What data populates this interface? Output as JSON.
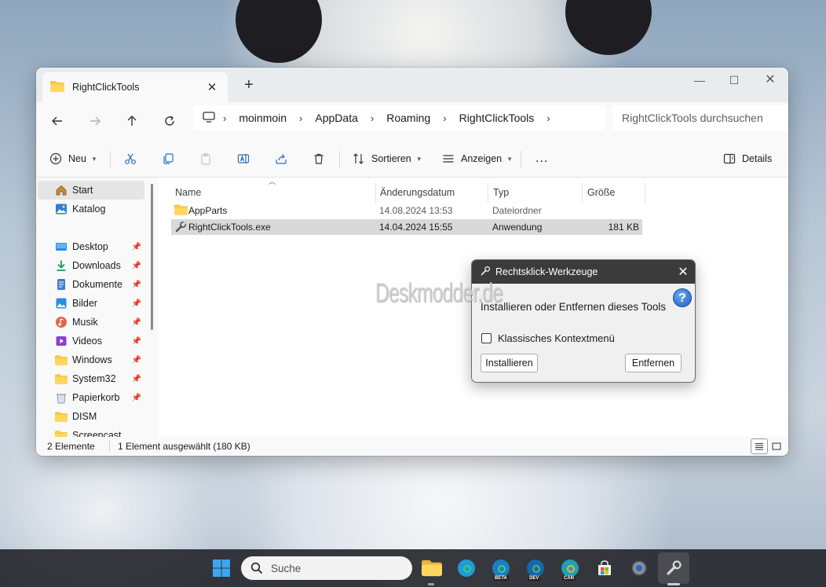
{
  "explorer": {
    "tab_title": "RightClickTools",
    "breadcrumb": [
      "moinmoin",
      "AppData",
      "Roaming",
      "RightClickTools"
    ],
    "search_placeholder": "RightClickTools durchsuchen",
    "toolbar": {
      "new_label": "Neu",
      "sort_label": "Sortieren",
      "view_label": "Anzeigen",
      "more_label": "...",
      "details_label": "Details"
    },
    "sidebar": {
      "items": [
        {
          "label": "Start",
          "icon": "home-icon"
        },
        {
          "label": "Katalog",
          "icon": "gallery-icon"
        },
        {
          "label": "Desktop",
          "icon": "desktop-icon"
        },
        {
          "label": "Downloads",
          "icon": "downloads-icon"
        },
        {
          "label": "Dokumente",
          "icon": "documents-icon"
        },
        {
          "label": "Bilder",
          "icon": "pictures-icon"
        },
        {
          "label": "Musik",
          "icon": "music-icon"
        },
        {
          "label": "Videos",
          "icon": "videos-icon"
        },
        {
          "label": "Windows",
          "icon": "folder-icon"
        },
        {
          "label": "System32",
          "icon": "folder-icon"
        },
        {
          "label": "Papierkorb",
          "icon": "recycle-bin-icon"
        },
        {
          "label": "DISM",
          "icon": "folder-icon"
        },
        {
          "label": "Screencast",
          "icon": "folder-icon"
        }
      ]
    },
    "columns": [
      "Name",
      "Änderungsdatum",
      "Typ",
      "Größe"
    ],
    "files": [
      {
        "name": "AppParts",
        "date": "14.08.2024 13:53",
        "type": "Dateiordner",
        "size": ""
      },
      {
        "name": "RightClickTools.exe",
        "date": "14.04.2024 15:55",
        "type": "Anwendung",
        "size": "181 KB"
      }
    ],
    "status": {
      "count": "2 Elemente",
      "selection": "1 Element ausgewählt (180 KB)"
    }
  },
  "dialog": {
    "title": "Rechtsklick-Werkzeuge",
    "message": "Installieren oder Entfernen dieses Tools",
    "checkbox_label": "Klassisches Kontextmenü",
    "install_label": "Installieren",
    "remove_label": "Entfernen"
  },
  "watermark": "Deskmodder.de",
  "taskbar": {
    "search_placeholder": "Suche",
    "badges": {
      "beta": "BETA",
      "dev": "DEV",
      "can": "CAN"
    }
  },
  "colors": {
    "folder": "#f6c844",
    "accent": "#0067c0",
    "dialog_titlebar": "#3b3b3b"
  }
}
